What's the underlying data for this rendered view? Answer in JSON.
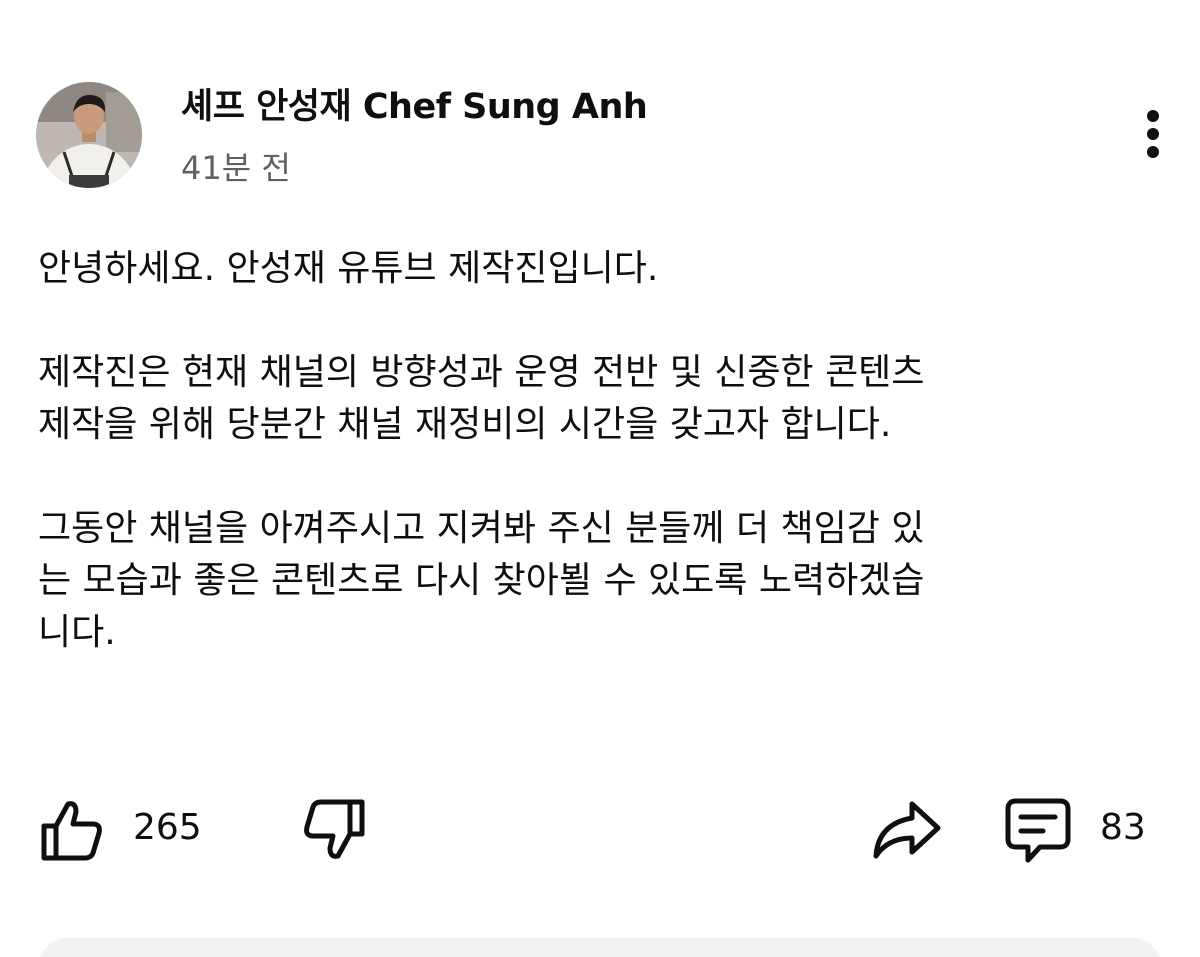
{
  "post": {
    "channel_name": "셰프 안성재 Chef Sung Anh",
    "time_ago": "41분 전",
    "body_lines": [
      "안녕하세요. 안성재 유튜브 제작진입니다.",
      "",
      "제작진은 현재 채널의 방향성과 운영 전반 및 신중한 콘텐츠",
      "제작을 위해 당분간 채널 재정비의 시간을 갖고자 합니다.",
      "",
      "그동안 채널을 아껴주시고 지켜봐 주신 분들께 더 책임감 있",
      "는 모습과 좋은 콘텐츠로 다시 찾아뵐 수 있도록 노력하겠습",
      "니다."
    ]
  },
  "actions": {
    "like_count": "265",
    "comment_count": "83"
  },
  "icons": {
    "more": "more-vertical-icon",
    "like": "thumbs-up-icon",
    "dislike": "thumbs-down-icon",
    "share": "share-arrow-icon",
    "comment": "comment-icon"
  }
}
